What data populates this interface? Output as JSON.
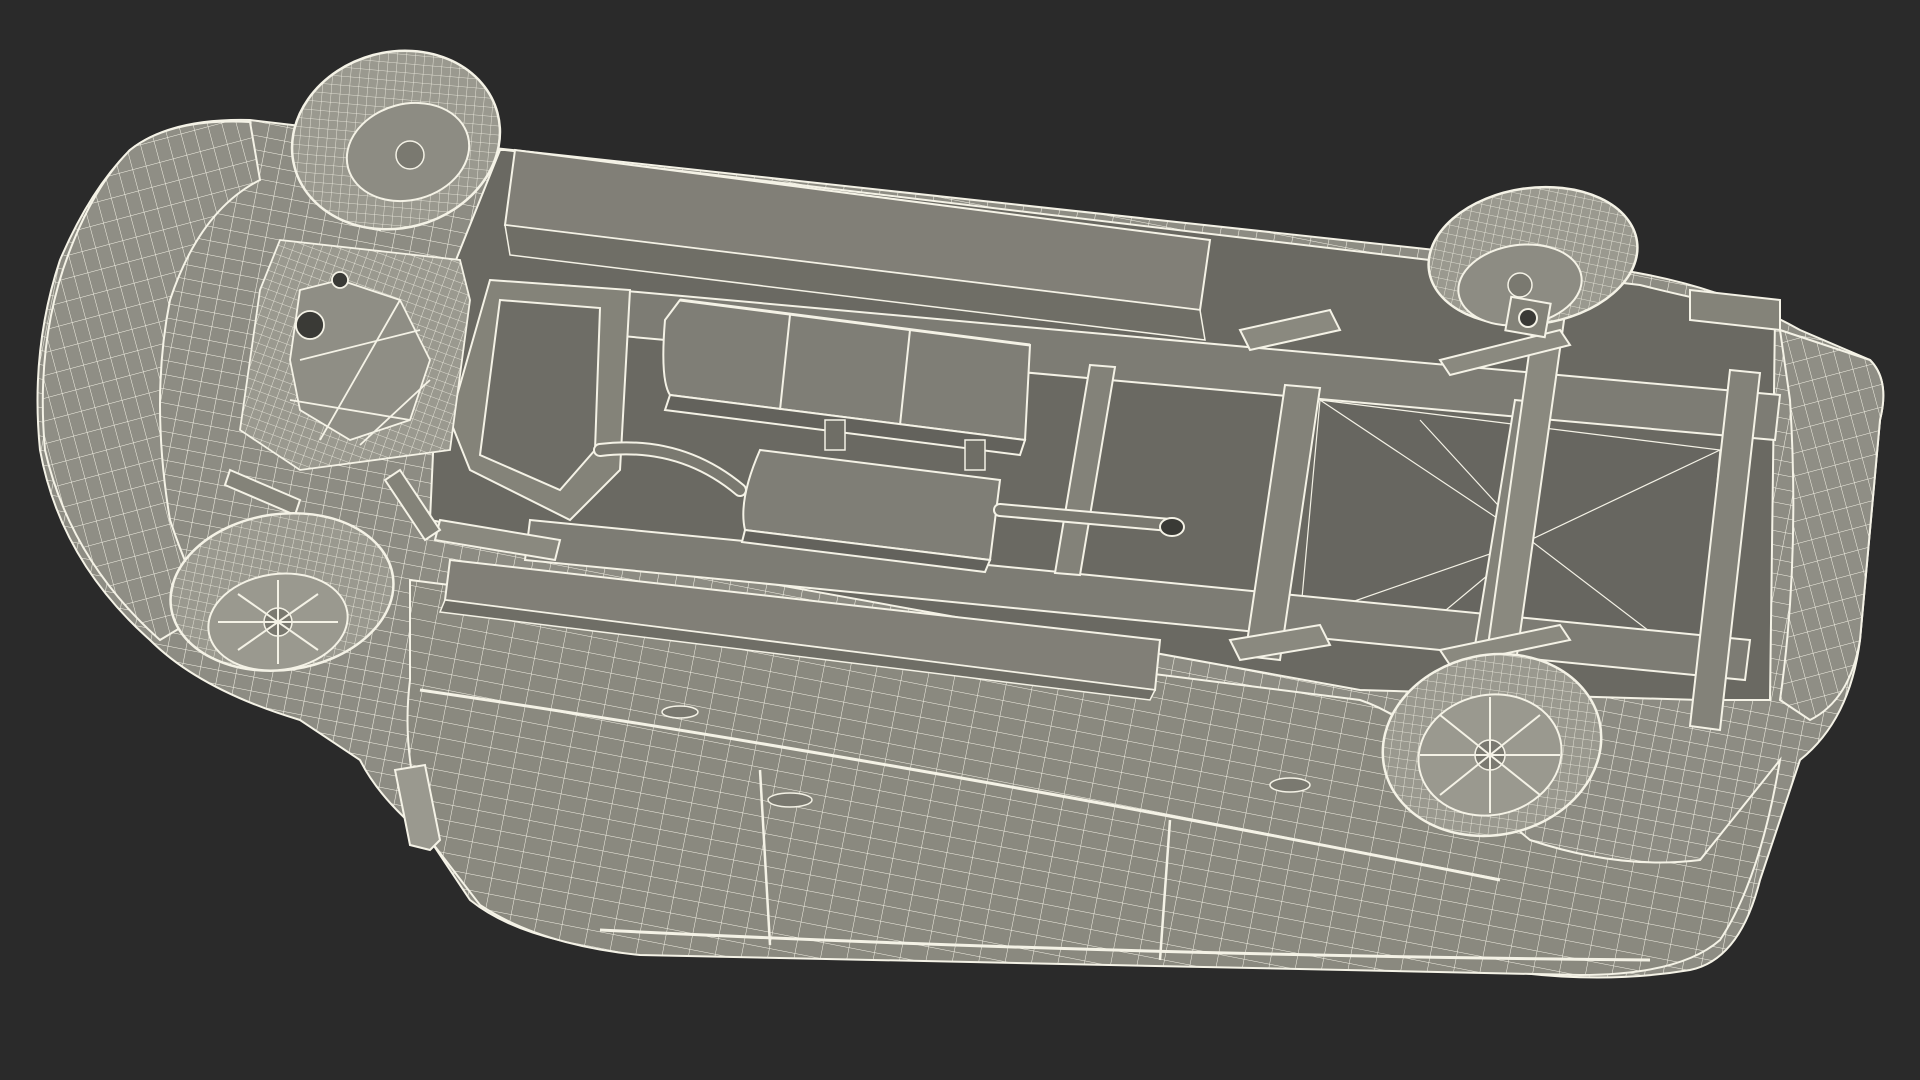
{
  "scene": {
    "subject": "wireframe-render",
    "colors": {
      "background": "#2a2a2a",
      "body_fill": "#8d8c83",
      "body_fill_dark": "#6f6e66",
      "body_fill_light": "#a3a298",
      "floor_fill": "#6a6962",
      "wire": "#f4f2e6",
      "wire_dim": "#d9d7ca",
      "tire_fill": "#9a998f",
      "shadow": "#3a3a36"
    },
    "icons": [
      "van-body",
      "chassis-frame",
      "fuel-tank",
      "exhaust-muffler",
      "wheel",
      "engine",
      "rear-axle"
    ]
  }
}
